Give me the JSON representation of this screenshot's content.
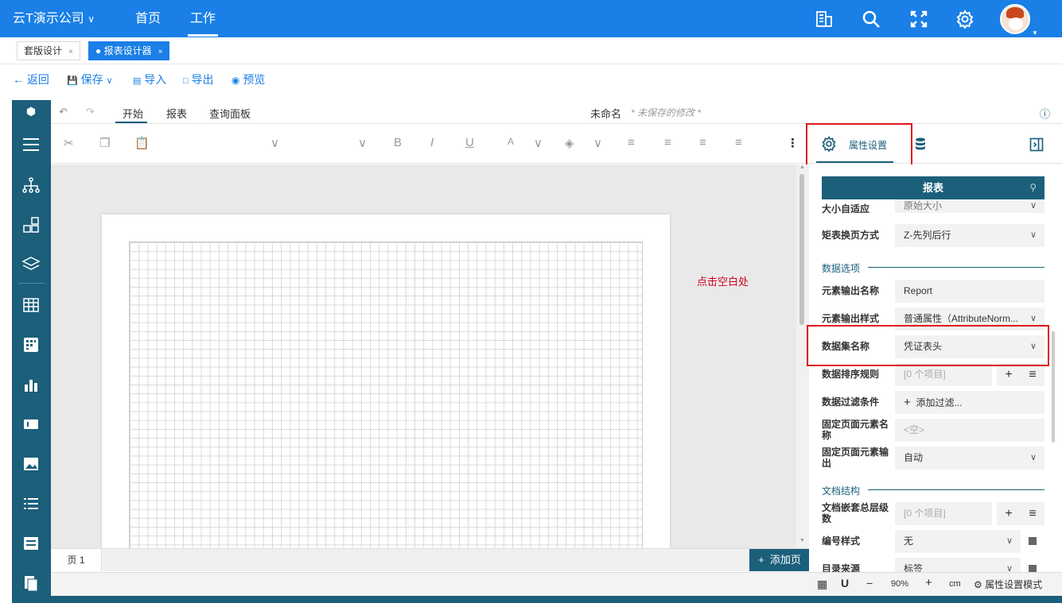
{
  "topbar": {
    "company": "云T演示公司",
    "nav_home": "首页",
    "nav_work": "工作"
  },
  "tabs": {
    "tab1": "套版设计",
    "tab2": "报表设计器",
    "close": "×"
  },
  "actions": {
    "back": "返回",
    "save": "保存",
    "import": "导入",
    "export": "导出",
    "preview": "预览"
  },
  "menu": {
    "start": "开始",
    "report": "报表",
    "query_panel": "查询面板",
    "doc_name": "未命名",
    "unsaved": "* 未保存的修改 *"
  },
  "canvas": {
    "hint": "点击空白处",
    "page_tab": "页 1",
    "add_page": "添加页"
  },
  "panel": {
    "tab_props": "属性设置",
    "search": "报表",
    "rows": {
      "auto_size": {
        "label": "大小自适应",
        "value": "原始大小"
      },
      "matrix_paging": {
        "label": "矩表换页方式",
        "value": "Z-先列后行"
      },
      "data_section": "数据选项",
      "element_output_name": {
        "label": "元素输出名称",
        "value": "Report"
      },
      "element_output_style": {
        "label": "元素输出样式",
        "value": "普通属性（AttributeNorm..."
      },
      "dataset_name": {
        "label": "数据集名称",
        "value": "凭证表头"
      },
      "sort_rule": {
        "label": "数据排序规则",
        "value": "[0 个项目]"
      },
      "filter": {
        "label": "数据过滤条件",
        "value": "添加过滤..."
      },
      "fixed_name": {
        "label": "固定页面元素名称",
        "value": "<空>"
      },
      "fixed_output": {
        "label": "固定页面元素输出",
        "value": "自动"
      },
      "doc_section": "文档结构",
      "nesting": {
        "label": "文档嵌套总层级数",
        "value": "[0 个项目]"
      },
      "numbering": {
        "label": "编号样式",
        "value": "无"
      },
      "toc_source": {
        "label": "目录来源",
        "value": "标签"
      }
    }
  },
  "status": {
    "zoom": "90%",
    "unit": "cm",
    "mode": "属性设置模式"
  },
  "colors": {
    "primary": "#1a7fe6",
    "dark": "#1b5f7b",
    "highlight": "#e0141e"
  }
}
